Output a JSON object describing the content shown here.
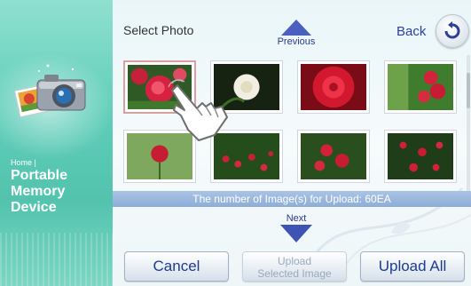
{
  "sidebar": {
    "home_label": "Home |",
    "title_lines": [
      "Portable",
      "Memory",
      "Device"
    ]
  },
  "header": {
    "title": "Select Photo",
    "back_label": "Back",
    "previous_label": "Previous"
  },
  "photos": [
    {
      "id": 1,
      "selected": true
    },
    {
      "id": 2,
      "selected": false
    },
    {
      "id": 3,
      "selected": false
    },
    {
      "id": 4,
      "selected": false
    },
    {
      "id": 5,
      "selected": false
    },
    {
      "id": 6,
      "selected": false
    },
    {
      "id": 7,
      "selected": false
    },
    {
      "id": 8,
      "selected": false
    }
  ],
  "info": {
    "upload_count_text": "The number of Image(s) for Upload:  60EA"
  },
  "nav": {
    "next_label": "Next"
  },
  "buttons": {
    "cancel": "Cancel",
    "upload_selected_line1": "Upload",
    "upload_selected_line2": "Selected Image",
    "upload_all": "Upload All"
  },
  "colors": {
    "accent": "#3e54b5",
    "sidebar": "#5fcdb9",
    "info_bar": "#8eadd7"
  }
}
